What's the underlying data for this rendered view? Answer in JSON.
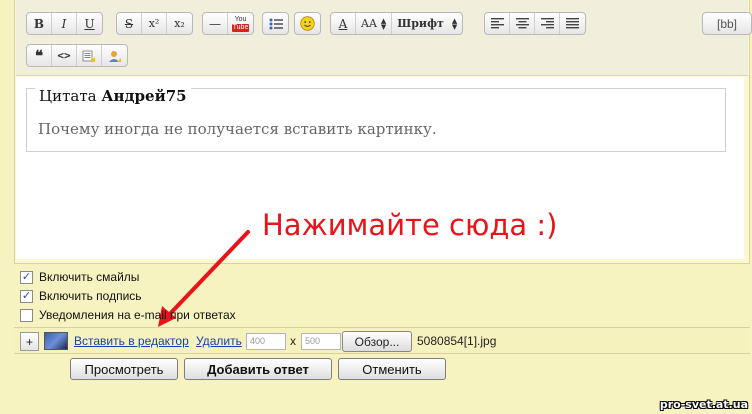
{
  "toolbar": {
    "bold": "B",
    "italic": "I",
    "underline": "U",
    "strike": "S",
    "superscript": "x²",
    "subscript": "x₂",
    "hr": "—",
    "youtube": "You Tube",
    "size_label": "AA",
    "font_label": "Шрифт",
    "bbcode": "[bb]",
    "quote": "“",
    "code": "<>"
  },
  "editor": {
    "quote_prefix": "Цитата",
    "quote_author": "Андрей75",
    "quote_text": "Почему иногда не получается вставить картинку."
  },
  "annotation": {
    "text": "Нажимайте сюда :)",
    "color": "#e8141a"
  },
  "options": [
    {
      "label": "Включить смайлы",
      "checked": true
    },
    {
      "label": "Включить подпись",
      "checked": true
    },
    {
      "label": "Уведомления на e-mail при ответах",
      "checked": false
    }
  ],
  "attachment": {
    "insert_label": "Вставить в редактор",
    "delete_label": "Удалить",
    "width_value": "400",
    "height_value": "500",
    "times": "x",
    "browse_label": "Обзор...",
    "filename": "5080854[1].jpg"
  },
  "actions": {
    "preview": "Просмотреть",
    "submit": "Добавить ответ",
    "cancel": "Отменить"
  },
  "watermark": "pro-svet.at.ua"
}
